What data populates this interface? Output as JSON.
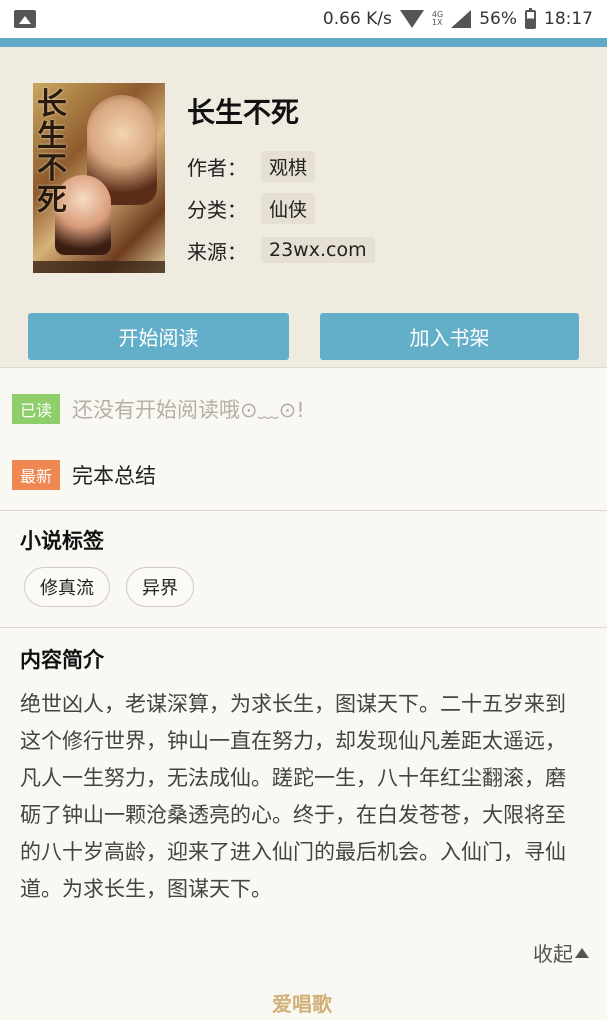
{
  "status_bar": {
    "speed": "0.66 K/s",
    "network_type": "4G",
    "network_sub": "1X",
    "battery": "56%",
    "time": "18:17"
  },
  "book": {
    "title": "长生不死",
    "cover_title": "长生不死",
    "author_label": "作者：",
    "author": "观棋",
    "category_label": "分类：",
    "category": "仙侠",
    "source_label": "来源：",
    "source": "23wx.com"
  },
  "actions": {
    "start_reading": "开始阅读",
    "add_to_shelf": "加入书架"
  },
  "chapters": {
    "read_badge": "已读",
    "read_text": "还没有开始阅读哦⊙﹏⊙!",
    "latest_badge": "最新",
    "latest_text": "完本总结"
  },
  "tags": {
    "title": "小说标签",
    "items": [
      "修真流",
      "异界"
    ]
  },
  "intro": {
    "title": "内容简介",
    "text": "绝世凶人，老谋深算，为求长生，图谋天下。二十五岁来到这个修行世界，钟山一直在努力，却发现仙凡差距太遥远，凡人一生努力，无法成仙。蹉跎一生，八十年红尘翻滚，磨砺了钟山一颗沧桑透亮的心。终于，在白发苍苍，大限将至的八十岁高龄，迎来了进入仙门的最后机会。入仙门，寻仙道。为求长生，图谋天下。",
    "collapse_label": "收起"
  },
  "watermark": "爱唱歌",
  "colors": {
    "accent": "#5fa9c6",
    "button": "#63afc9",
    "read_badge": "#8fcf6b",
    "new_badge": "#ef8752",
    "header_bg": "#efebe1"
  }
}
